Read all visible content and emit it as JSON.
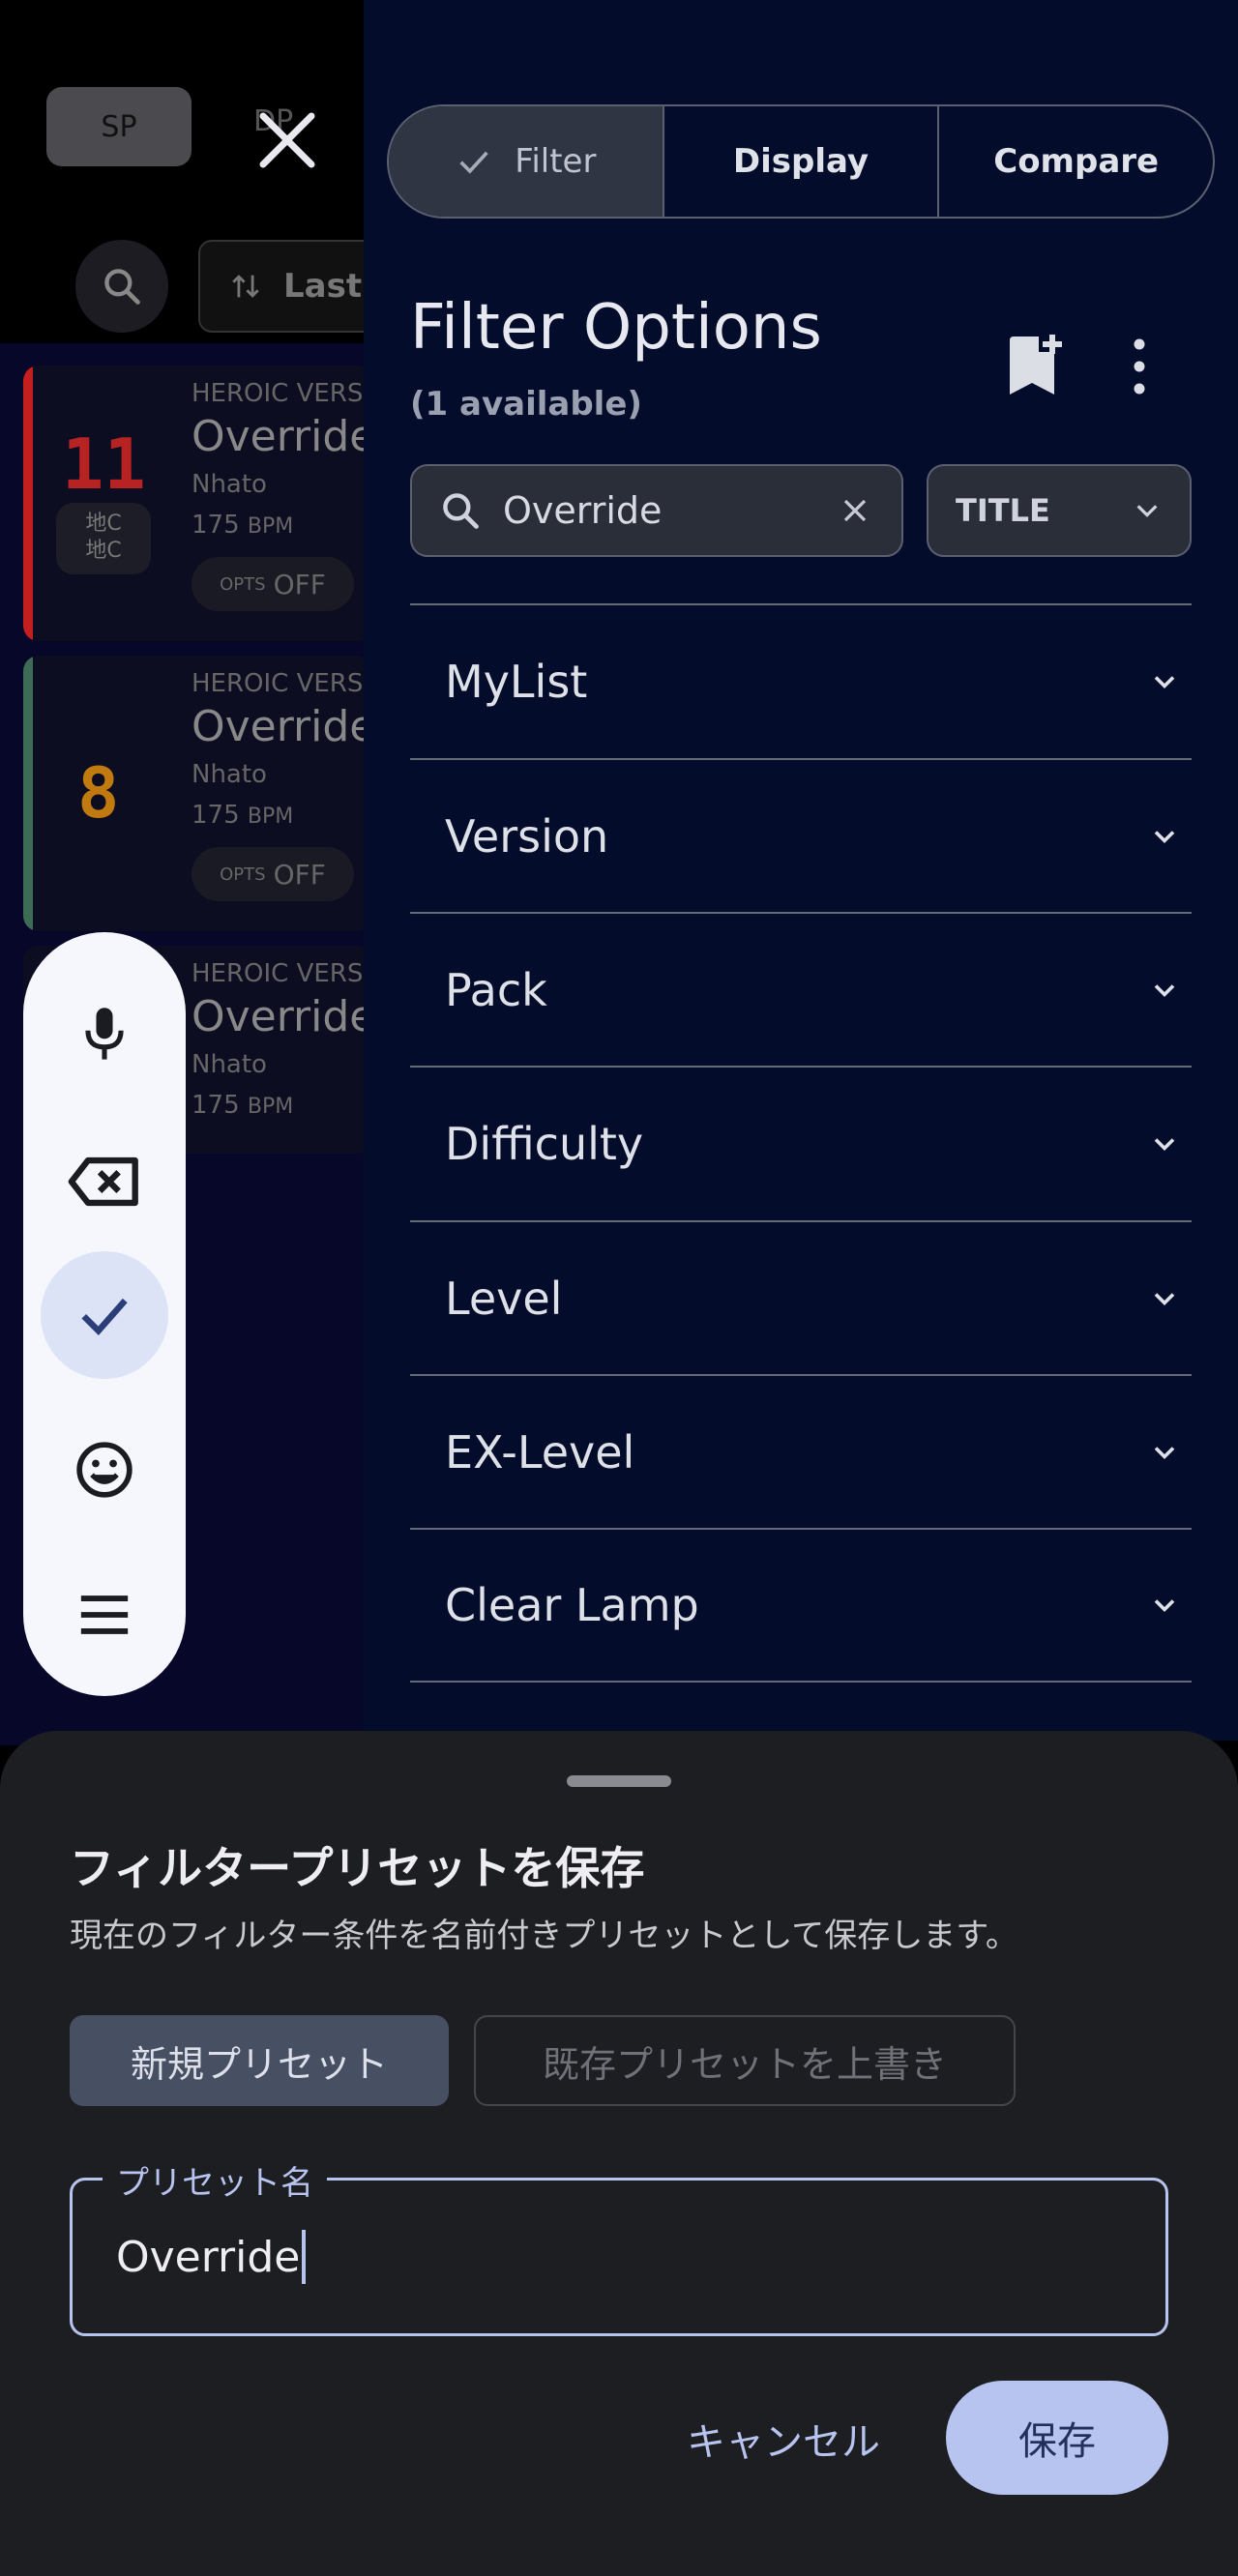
{
  "background": {
    "play_style_button": "SP",
    "double_label": "DP",
    "sort_label": "Last",
    "songs": [
      {
        "version": "HEROIC VERS",
        "title": "Override",
        "artist": "Nhato",
        "bpm_value": "175",
        "bpm_unit": "BPM",
        "level": "11",
        "tag_line1": "地C",
        "tag_line2": "地C",
        "opts_label": "OPTS",
        "opts_value": "OFF",
        "stripe_color": "#c41f1f",
        "level_color": "#b72323"
      },
      {
        "version": "HEROIC VERS",
        "title": "Override",
        "artist": "Nhato",
        "bpm_value": "175",
        "bpm_unit": "BPM",
        "level": "8",
        "opts_label": "OPTS",
        "opts_value": "OFF",
        "stripe_color": "#3d6b55",
        "level_color": "#c07a10"
      },
      {
        "version": "HEROIC VERS",
        "title": "Override",
        "artist": "Nhato",
        "bpm_value": "175",
        "bpm_unit": "BPM"
      }
    ]
  },
  "panel": {
    "tabs": [
      {
        "label": "Filter",
        "active": true,
        "icon": "check-icon"
      },
      {
        "label": "Display",
        "active": false
      },
      {
        "label": "Compare",
        "active": false
      }
    ],
    "title": "Filter Options",
    "subtitle": "(1 available)",
    "search": {
      "value": "Override",
      "icon": "search-icon"
    },
    "field_select": "TITLE",
    "sections": [
      "MyList",
      "Version",
      "Pack",
      "Difficulty",
      "Level",
      "EX-Level",
      "Clear Lamp"
    ]
  },
  "keyboard_toolbar": {
    "buttons": [
      "mic-icon",
      "backspace-icon",
      "check-icon",
      "emoji-icon",
      "menu-icon"
    ]
  },
  "sheet": {
    "title": "フィルタープリセットを保存",
    "description": "現在のフィルター条件を名前付きプリセットとして保存します。",
    "new_preset": "新規プリセット",
    "overwrite_preset": "既存プリセットを上書き",
    "name_label": "プリセット名",
    "name_value": "Override",
    "cancel": "キャンセル",
    "save": "保存"
  },
  "colors": {
    "panel_bg": "#030c2a",
    "sheet_bg": "#1d1e21",
    "accent": "#b8c4f0"
  }
}
